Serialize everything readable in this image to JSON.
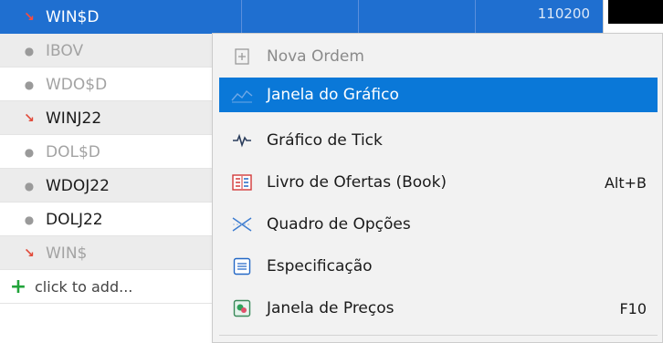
{
  "market_watch": {
    "rows": [
      {
        "symbol": "WIN$D",
        "marker": "arrow-down",
        "dimmed": false,
        "selected": true,
        "alt": false
      },
      {
        "symbol": "IBOV",
        "marker": "dot",
        "dimmed": true,
        "selected": false,
        "alt": true
      },
      {
        "symbol": "WDO$D",
        "marker": "dot",
        "dimmed": true,
        "selected": false,
        "alt": false
      },
      {
        "symbol": "WINJ22",
        "marker": "arrow-down",
        "dimmed": false,
        "selected": false,
        "alt": true
      },
      {
        "symbol": "DOL$D",
        "marker": "dot",
        "dimmed": true,
        "selected": false,
        "alt": false
      },
      {
        "symbol": "WDOJ22",
        "marker": "dot",
        "dimmed": false,
        "selected": false,
        "alt": true
      },
      {
        "symbol": "DOLJ22",
        "marker": "dot",
        "dimmed": false,
        "selected": false,
        "alt": false
      },
      {
        "symbol": "WIN$",
        "marker": "arrow-down",
        "dimmed": true,
        "selected": false,
        "alt": true
      }
    ],
    "selected_price": "110200",
    "add_label": "click to add..."
  },
  "context_menu": {
    "items": [
      {
        "label": "Nova Ordem",
        "shortcut": "",
        "icon": "new-order-icon",
        "disabled": true,
        "highlighted": false
      },
      {
        "label": "Janela do Gráfico",
        "shortcut": "",
        "icon": "chart-window-icon",
        "disabled": false,
        "highlighted": true
      },
      {
        "label": "Gráfico de Tick",
        "shortcut": "",
        "icon": "tick-chart-icon",
        "disabled": false,
        "highlighted": false
      },
      {
        "label": "Livro de Ofertas (Book)",
        "shortcut": "Alt+B",
        "icon": "order-book-icon",
        "disabled": false,
        "highlighted": false
      },
      {
        "label": "Quadro de Opções",
        "shortcut": "",
        "icon": "options-board-icon",
        "disabled": false,
        "highlighted": false
      },
      {
        "label": "Especificação",
        "shortcut": "",
        "icon": "specification-icon",
        "disabled": false,
        "highlighted": false
      },
      {
        "label": "Janela de Preços",
        "shortcut": "F10",
        "icon": "price-window-icon",
        "disabled": false,
        "highlighted": false
      }
    ]
  },
  "colors": {
    "selection": "#1f6fd0",
    "menu_highlight": "#0a78d8",
    "down_arrow": "#e14a3a",
    "add_plus": "#21a33a"
  }
}
